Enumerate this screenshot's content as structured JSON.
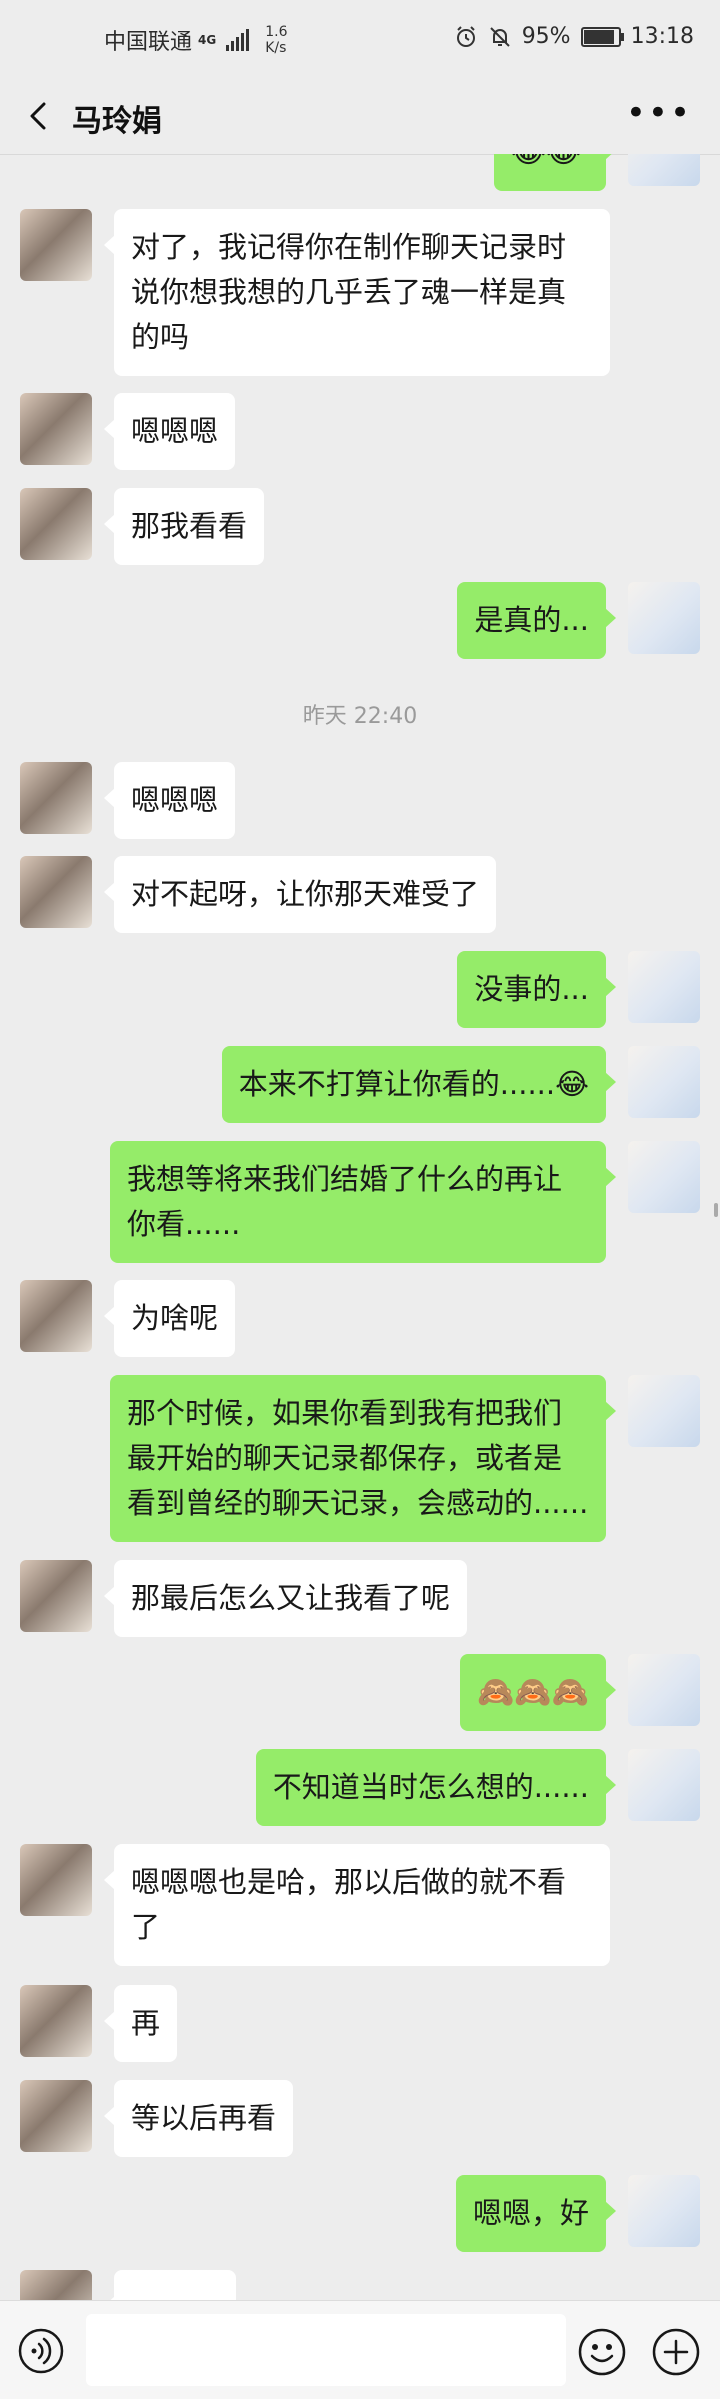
{
  "status": {
    "carrier": "中国联通",
    "network": "4G",
    "speed_value": "1.6",
    "speed_unit": "K/s",
    "battery": "95%",
    "battery_level": 0.95,
    "time": "13:18"
  },
  "header": {
    "title": "马玲娟",
    "more_icon": "more-icon"
  },
  "messages": [
    {
      "side": "right",
      "text": "😂😂"
    },
    {
      "side": "left",
      "text": "对了，我记得你在制作聊天记录时说你想我想的几乎丢了魂一样是真的吗"
    },
    {
      "side": "left",
      "text": "嗯嗯嗯"
    },
    {
      "side": "left",
      "text": "那我看看"
    },
    {
      "side": "right",
      "text": "是真的..."
    },
    {
      "side": "left",
      "text": "嗯嗯嗯"
    },
    {
      "side": "left",
      "text": "对不起呀，让你那天难受了"
    },
    {
      "side": "right",
      "text": "没事的..."
    },
    {
      "side": "right",
      "text": "本来不打算让你看的......😂"
    },
    {
      "side": "right",
      "text": "我想等将来我们结婚了什么的再让你看......"
    },
    {
      "side": "left",
      "text": "为啥呢"
    },
    {
      "side": "right",
      "text": "那个时候，如果你看到我有把我们最开始的聊天记录都保存，或者是看到曾经的聊天记录，会感动的......"
    },
    {
      "side": "left",
      "text": "那最后怎么又让我看了呢"
    },
    {
      "side": "right",
      "text": "🙈🙈🙈"
    },
    {
      "side": "right",
      "text": "不知道当时怎么想的......"
    },
    {
      "side": "left",
      "text": "嗯嗯嗯也是哈，那以后做的就不看了"
    },
    {
      "side": "left",
      "text": "再"
    },
    {
      "side": "left",
      "text": "等以后再看"
    },
    {
      "side": "right",
      "text": "嗯嗯，好"
    },
    {
      "side": "left",
      "text": ""
    }
  ],
  "timestamp": "昨天 22:40",
  "input_bar": {
    "voice_icon": "voice-icon",
    "emoji_icon": "emoji-icon",
    "plus_icon": "plus-icon",
    "input_value": ""
  },
  "colors": {
    "background": "#ededed",
    "bubble_self": "#95ec69",
    "bubble_other": "#ffffff",
    "timestamp_text": "#9a9a9a"
  }
}
